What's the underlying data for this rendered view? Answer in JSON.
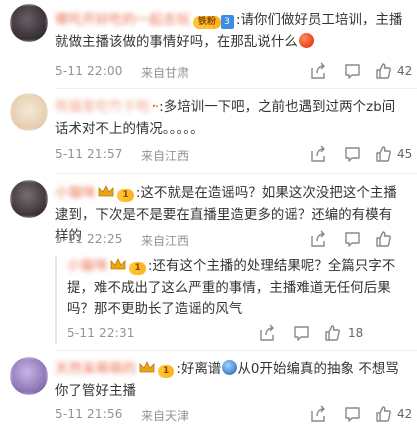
{
  "comments": [
    {
      "username": "哪吒开好吃的一起去玩",
      "fan_badge": {
        "level": "铁粉",
        "num": "3"
      },
      "text": "请你们做好员工培训，主播就做主播该做的事情好吗，在那乱说什么",
      "time": "5-11 22:00",
      "source": "来自甘肃",
      "likes": "42",
      "avatar_icon": "user-avatar",
      "emoji": "angry-face"
    },
    {
      "username": "熊猫爱吃竹子啦",
      "text": "多培训一下吧，之前也遇到过两个zb间话术对不上的情况。。。。。",
      "time": "5-11 21:57",
      "source": "来自江西",
      "likes": "45",
      "avatar_icon": "user-avatar"
    },
    {
      "username": "小猫咪",
      "crown_badge": "1",
      "text": "这不就是在造谣吗？如果这次没把这个主播逮到，下次是不是要在直播里造更多的谣？还编的有模有样的",
      "time": "5-11 22:25",
      "source": "来自江西",
      "likes": "",
      "avatar_icon": "user-avatar",
      "reply": {
        "username": "小猫咪",
        "crown_badge": "1",
        "text": "还有这个主播的处理结果呢？全篇只字不提，难不成出了这么严重的事情，主播难道无任何后果吗？那不更助长了造谣的风气",
        "time": "5-11 22:31",
        "likes": "18"
      }
    },
    {
      "username": "天然呆萌萌的",
      "crown_badge": "1",
      "text_a": "好离谱",
      "text_b": "从0开始编真的抽象 不想骂你了管好主播",
      "time": "5-11 21:56",
      "source": "来自天津",
      "likes": "42",
      "avatar_icon": "user-avatar",
      "emoji": "sweat-face"
    }
  ]
}
